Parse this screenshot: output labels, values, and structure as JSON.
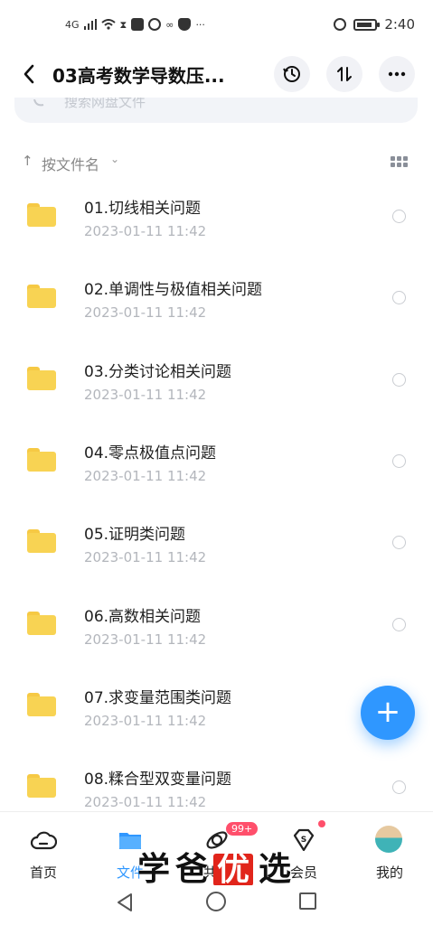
{
  "status_bar": {
    "network": "4G",
    "time": "2:40"
  },
  "header": {
    "title": "03高考数学导数压..."
  },
  "search": {
    "placeholder": "搜索网盘文件"
  },
  "sort": {
    "label": "按文件名"
  },
  "files": [
    {
      "name": "01.切线相关问题",
      "date": "2023-01-11  11:42"
    },
    {
      "name": "02.单调性与极值相关问题",
      "date": "2023-01-11  11:42"
    },
    {
      "name": "03.分类讨论相关问题",
      "date": "2023-01-11  11:42"
    },
    {
      "name": "04.零点极值点问题",
      "date": "2023-01-11  11:42"
    },
    {
      "name": "05.证明类问题",
      "date": "2023-01-11  11:42"
    },
    {
      "name": "06.高数相关问题",
      "date": "2023-01-11  11:42"
    },
    {
      "name": "07.求变量范围类问题",
      "date": "2023-01-11  11:42"
    },
    {
      "name": "08.糅合型双变量问题",
      "date": "2023-01-11  11:42"
    }
  ],
  "fab": {
    "icon": "plus-icon",
    "color": "#2f97ff"
  },
  "bottom_nav": {
    "home": "首页",
    "files": "文件",
    "share": "共享",
    "share_badge": "99+",
    "vip": "会员",
    "mine": "我的",
    "active_color": "#2f97ff"
  },
  "watermark": {
    "c1": "学",
    "c2": "爸",
    "c3": "优",
    "c4": "选"
  }
}
